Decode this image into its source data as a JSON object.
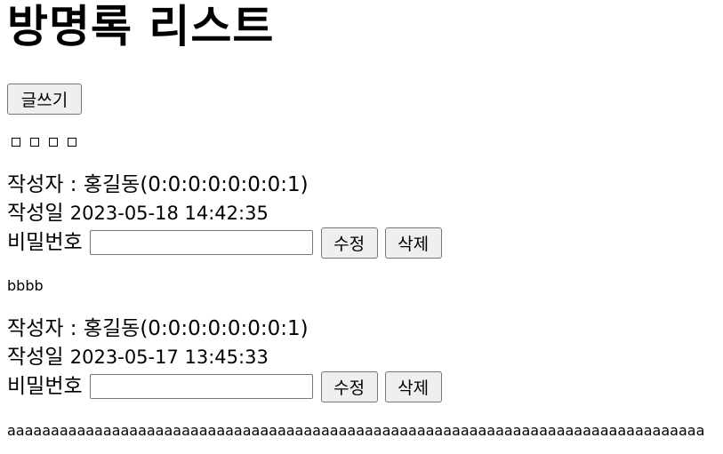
{
  "page": {
    "title": "방명록 리스트",
    "write_button_label": "글쓰기"
  },
  "icons": {
    "missing_glyph": "missing-glyph-box-icon"
  },
  "entries": [
    {
      "author_line": "작성자 : 홍길동(0:0:0:0:0:0:0:1)",
      "date_label": "작성일",
      "date_value": "2023-05-18 14:42:35",
      "password_label": "비밀번호",
      "password_value": "",
      "edit_label": "수정",
      "delete_label": "삭제",
      "content": "bbbb"
    },
    {
      "author_line": "작성자 : 홍길동(0:0:0:0:0:0:0:1)",
      "date_label": "작성일",
      "date_value": "2023-05-17 13:45:33",
      "password_label": "비밀번호",
      "password_value": "",
      "edit_label": "수정",
      "delete_label": "삭제",
      "content": "aaaaaaaaaaaaaaaaaaaaaaaaaaaaaaaaaaaaaaaaaaaaaaaaaaaaaaaaaaaaaaaaaaaaaaaaaaaaaaaa"
    }
  ]
}
